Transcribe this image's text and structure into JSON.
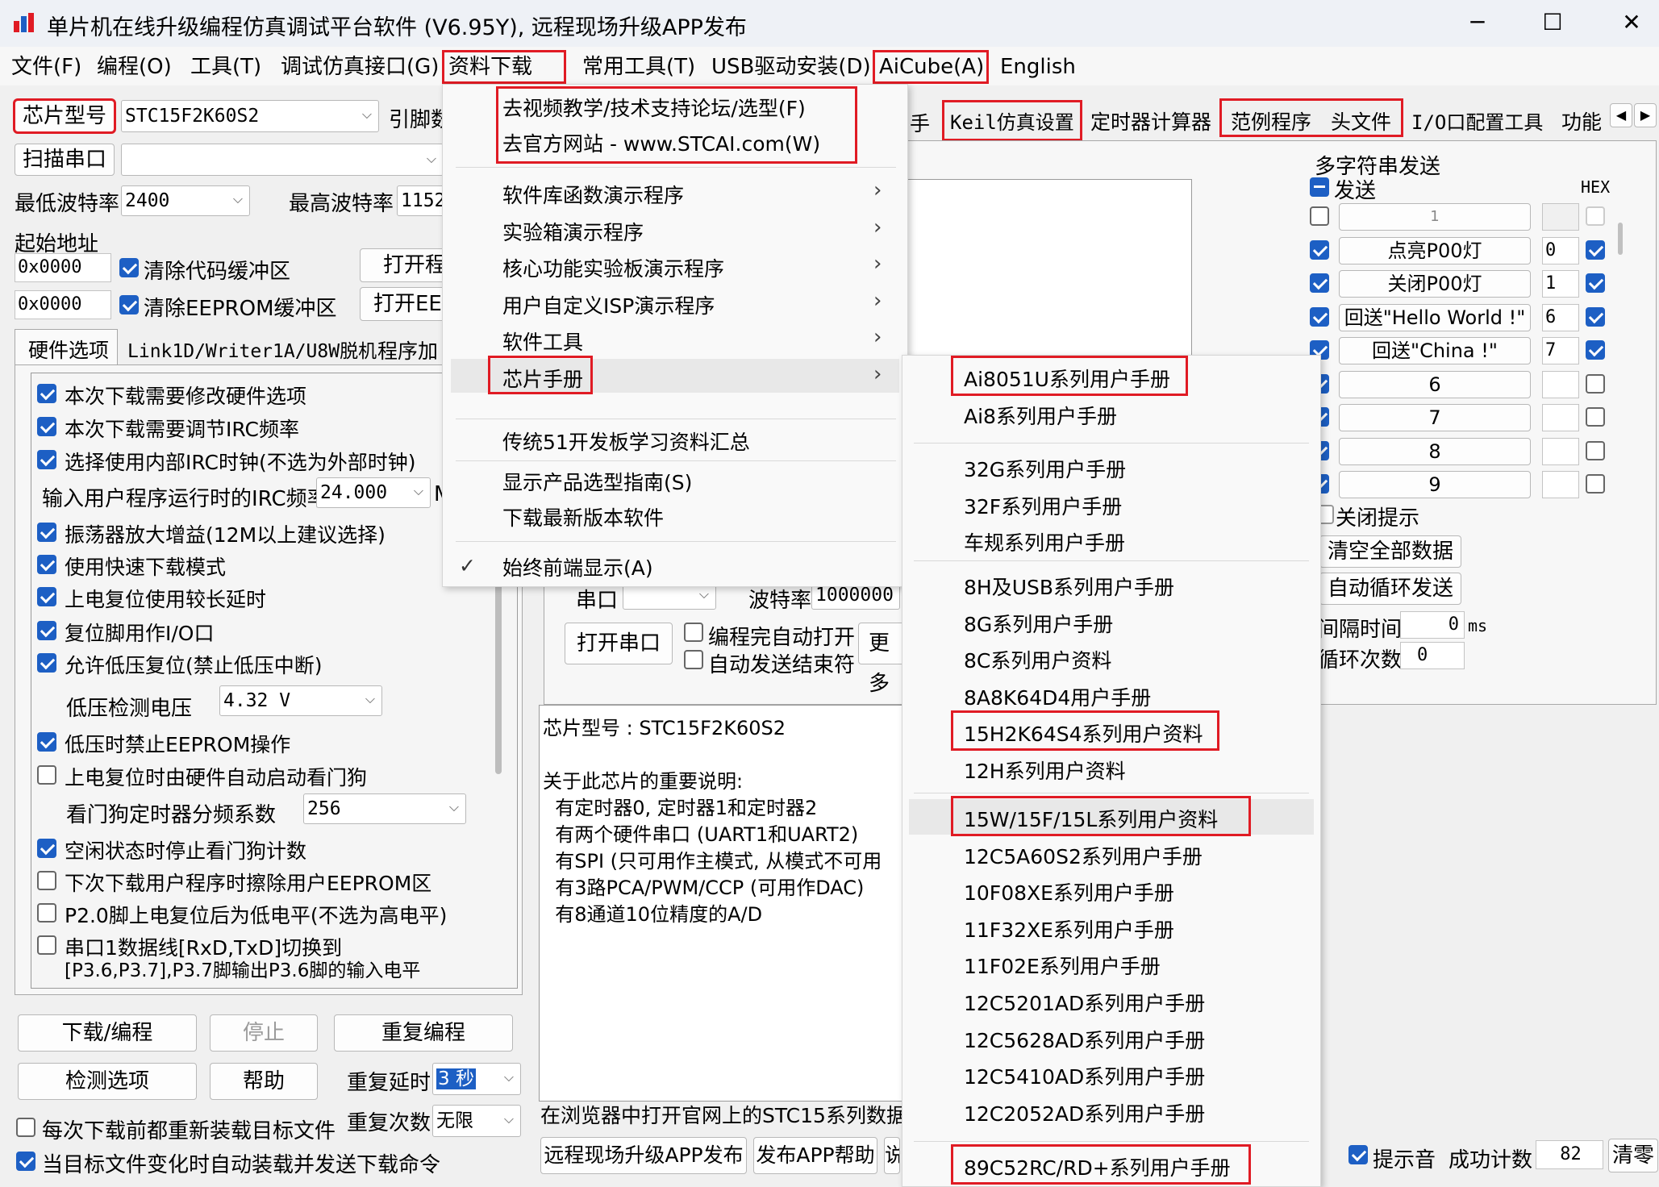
{
  "window": {
    "title": "单片机在线升级编程仿真调试平台软件 (V6.95Y), 远程现场升级APP发布",
    "minimize": "─",
    "maximize": "☐",
    "close": "✕"
  },
  "menubar": [
    "文件(F)",
    "编程(O)",
    "工具(T)",
    "调试仿真接口(G)",
    "资料下载(D)",
    "常用工具(T)",
    "USB驱动安装(D)",
    "AiCube(A)",
    "English"
  ],
  "left": {
    "chip_type_button": "芯片型号",
    "chip_type_value": "STC15F2K60S2",
    "pin_label": "引脚数",
    "scan_port_button": "扫描串口",
    "min_baud_label": "最低波特率",
    "min_baud_value": "2400",
    "max_baud_label": "最高波特率",
    "max_baud_value": "1152",
    "start_addr_label": "起始地址",
    "addr1": "0x0000",
    "clear_code": "清除代码缓冲区",
    "open_prog": "打开程",
    "addr2": "0x0000",
    "clear_eeprom": "清除EEPROM缓冲区",
    "open_eep": "打开EE",
    "tabs": [
      "硬件选项",
      "Link1D/Writer1A/U8W脱机",
      "程序加"
    ],
    "options": [
      {
        "label": "本次下载需要修改硬件选项",
        "checked": true
      },
      {
        "label": "本次下载需要调节IRC频率",
        "checked": true
      },
      {
        "label": "选择使用内部IRC时钟(不选为外部时钟)",
        "checked": true
      },
      {
        "label": "振荡器放大增益(12M以上建议选择)",
        "checked": true
      },
      {
        "label": "使用快速下载模式",
        "checked": true
      },
      {
        "label": "上电复位使用较长延时",
        "checked": true
      },
      {
        "label": "复位脚用作I/O口",
        "checked": true
      },
      {
        "label": "允许低压复位(禁止低压中断)",
        "checked": true
      },
      {
        "label": "低压时禁止EEPROM操作",
        "checked": true
      },
      {
        "label": "上电复位时由硬件自动启动看门狗",
        "checked": false
      },
      {
        "label": "空闲状态时停止看门狗计数",
        "checked": true
      },
      {
        "label": "下次下载用户程序时擦除用户EEPROM区",
        "checked": false
      },
      {
        "label": "P2.0脚上电复位后为低电平(不选为高电平)",
        "checked": false
      },
      {
        "label": "串口1数据线[RxD,TxD]切换到",
        "label2": "[P3.6,P3.7],P3.7脚输出P3.6脚的输入电平",
        "checked": false
      }
    ],
    "irc_label": "输入用户程序运行时的IRC频率",
    "irc_value": "24.000",
    "irc_unit": "M",
    "lvd_label": "低压检测电压",
    "lvd_value": "4.32 V",
    "wdt_label": "看门狗定时器分频系数",
    "wdt_value": "256",
    "download_button": "下载/编程",
    "stop_button": "停止",
    "reprogram_button": "重复编程",
    "check_button": "检测选项",
    "help_button": "帮助",
    "repeat_delay_label": "重复延时",
    "repeat_delay_value": "3 秒",
    "repeat_count_label": "重复次数",
    "repeat_count_value": "无限",
    "reload_each": "每次下载前都重新装载目标文件",
    "auto_reload": "当目标文件变化时自动装载并发送下载命令"
  },
  "middle": {
    "tabs_visible": [
      "手",
      "Keil仿真设置",
      "定时器计算器",
      "范例程序",
      "头文件",
      "I/O口配置工具",
      "功能"
    ],
    "port_label": "串口",
    "baud_label": "波特率",
    "baud_value": "1000000",
    "open_port": "打开串口",
    "auto_open": "编程完自动打开",
    "auto_end": "自动发送结束符",
    "more": "更多",
    "info_lines": [
      "芯片型号 : STC15F2K60S2",
      "",
      "关于此芯片的重要说明:",
      "  有定时器0, 定时器1和定时器2",
      "  有两个硬件串口 (UART1和UART2)",
      "  有SPI (只可用作主模式, 从模式不可用",
      "  有3路PCA/PWM/CCP (可用作DAC)",
      "  有8通道10位精度的A/D"
    ],
    "browser_link": "在浏览器中打开官网上的STC15系列数据手",
    "remote_app": "远程现场升级APP发布",
    "publish_help": "发布APP帮助",
    "cut": "说"
  },
  "right": {
    "multi_send_title": "多字符串发送",
    "send_label": "发送",
    "hex_label": "HEX",
    "rows": [
      {
        "check": false,
        "text": "1",
        "num": "",
        "hex": false
      },
      {
        "check": true,
        "text": "点亮P00灯",
        "num": "0",
        "hex": true
      },
      {
        "check": true,
        "text": "关闭P00灯",
        "num": "1",
        "hex": true
      },
      {
        "check": true,
        "text": "回送\"Hello World !\"",
        "num": "6",
        "hex": true
      },
      {
        "check": true,
        "text": "回送\"China !\"",
        "num": "7",
        "hex": true
      },
      {
        "check": true,
        "text": "6",
        "num": "",
        "hex": false
      },
      {
        "check": true,
        "text": "7",
        "num": "",
        "hex": false
      },
      {
        "check": true,
        "text": "8",
        "num": "",
        "hex": false
      },
      {
        "check": true,
        "text": "9",
        "num": "",
        "hex": false
      }
    ],
    "close_hint": "关闭提示",
    "clear_all": "清空全部数据",
    "auto_loop": "自动循环发送",
    "interval_label": "间隔时间",
    "interval_value": "0",
    "interval_unit": "ms",
    "loop_label": "循环次数",
    "loop_value": "0",
    "sound_label": "提示音",
    "success_label": "成功计数",
    "success_value": "82",
    "clear_button": "清零"
  },
  "download_menu": {
    "top_items": [
      "去视频教学/技术支持论坛/选型(F)",
      "去官方网站 - www.STCAI.com(W)"
    ],
    "items": [
      {
        "label": "软件库函数演示程序",
        "submenu": true
      },
      {
        "label": "实验箱演示程序",
        "submenu": true
      },
      {
        "label": "核心功能实验板演示程序",
        "submenu": true
      },
      {
        "label": "用户自定义ISP演示程序",
        "submenu": true
      },
      {
        "label": "软件工具",
        "submenu": true
      },
      {
        "label": "芯片手册",
        "submenu": true
      }
    ],
    "traditional": "传统51开发板学习资料汇总",
    "show_guide": "显示产品选型指南(S)",
    "download_latest": "下载最新版本软件",
    "always_front": "始终前端显示(A)",
    "checkmark": "✓"
  },
  "manual_submenu": {
    "group1": [
      "Ai8051U系列用户手册",
      "Ai8系列用户手册"
    ],
    "group2": [
      "32G系列用户手册",
      "32F系列用户手册",
      "车规系列用户手册"
    ],
    "group3": [
      "8H及USB系列用户手册",
      "8G系列用户手册",
      "8C系列用户资料",
      "8A8K64D4用户手册",
      "15H2K64S4系列用户资料",
      "12H系列用户资料"
    ],
    "group4": [
      "15W/15F/15L系列用户资料",
      "12C5A60S2系列用户手册",
      "10F08XE系列用户手册",
      "11F32XE系列用户手册",
      "11F02E系列用户手册",
      "12C5201AD系列用户手册",
      "12C5628AD系列用户手册",
      "12C5410AD系列用户手册",
      "12C2052AD系列用户手册"
    ],
    "group5": [
      "89C52RC/RD+系列用户手册"
    ]
  },
  "colors": {
    "highlight": "#e01b24",
    "checkbox": "#1d5fc4",
    "menu_hover": "#e8e8e8"
  }
}
